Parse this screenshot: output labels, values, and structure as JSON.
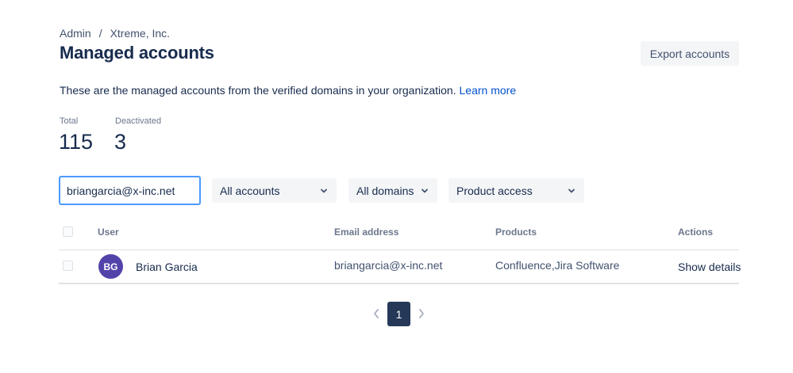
{
  "breadcrumb": {
    "parent": "Admin",
    "separator": "/",
    "current": "Xtreme, Inc."
  },
  "page": {
    "title": "Managed accounts",
    "description": "These are the managed accounts from the verified domains in your organization.",
    "learn_more": "Learn more"
  },
  "toolbar": {
    "export_label": "Export accounts"
  },
  "stats": {
    "total_label": "Total",
    "total_value": "115",
    "deactivated_label": "Deactivated",
    "deactivated_value": "3"
  },
  "filters": {
    "search_value": "briangarcia@x-inc.net",
    "accounts_label": "All accounts",
    "domains_label": "All domains",
    "product_label": "Product access"
  },
  "table": {
    "headers": {
      "user": "User",
      "email": "Email address",
      "products": "Products",
      "actions": "Actions"
    },
    "rows": [
      {
        "initials": "BG",
        "name": "Brian Garcia",
        "email": "briangarcia@x-inc.net",
        "products": "Confluence,Jira Software",
        "action": "Show details"
      }
    ]
  },
  "pagination": {
    "current_page": "1"
  },
  "colors": {
    "primary_text": "#172b4d",
    "link": "#0052cc",
    "avatar_bg": "#5243aa",
    "focus_border": "#4c9aff",
    "page_active": "#253858"
  },
  "icons": [
    "chevron-down-icon",
    "chevron-left-icon",
    "chevron-right-icon"
  ]
}
